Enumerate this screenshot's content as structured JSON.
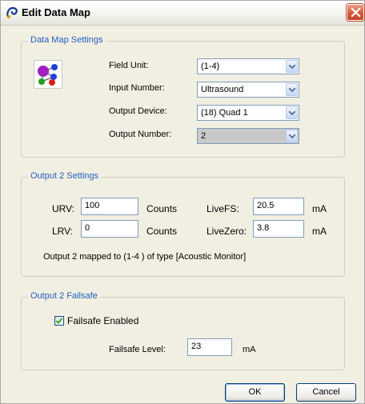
{
  "window": {
    "title": "Edit Data Map",
    "title_icon": "data-map-icon",
    "close_icon": "close-icon"
  },
  "data_map_settings": {
    "legend": "Data Map Settings",
    "icon": "network-nodes-icon",
    "field_unit": {
      "label": "Field Unit:",
      "value": "(1-4)"
    },
    "input_number": {
      "label": "Input Number:",
      "value": "Ultrasound"
    },
    "output_device": {
      "label": "Output Device:",
      "value": "(18) Quad 1"
    },
    "output_number": {
      "label": "Output Number:",
      "value": "2"
    }
  },
  "output_settings": {
    "legend": "Output 2 Settings",
    "urv": {
      "label": "URV:",
      "value": "100",
      "unit": "Counts"
    },
    "lrv": {
      "label": "LRV:",
      "value": "0",
      "unit": "Counts"
    },
    "live_fs": {
      "label": "LiveFS:",
      "value": "20.5",
      "unit": "mA"
    },
    "live_zero": {
      "label": "LiveZero:",
      "value": "3.8",
      "unit": "mA"
    },
    "mapping_text": "Output 2 mapped to  (1-4 ) of type [Acoustic Monitor]"
  },
  "failsafe": {
    "legend": "Output 2 Failsafe",
    "enabled_label": "Failsafe Enabled",
    "enabled": true,
    "level_label": "Failsafe Level:",
    "level_value": "23",
    "level_unit": "mA"
  },
  "buttons": {
    "ok": "OK",
    "cancel": "Cancel"
  }
}
